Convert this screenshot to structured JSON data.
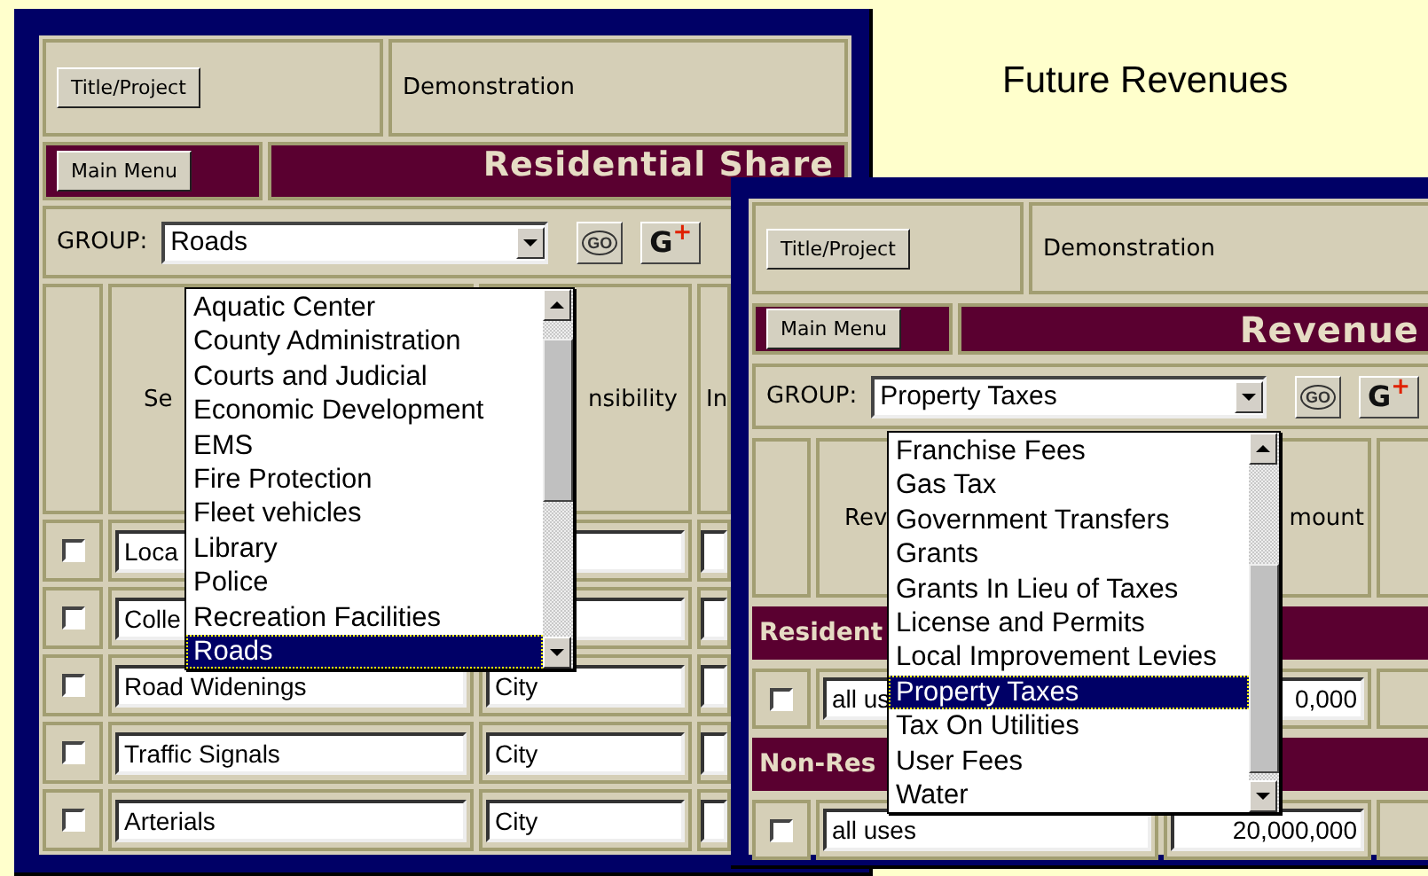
{
  "slide_title": "Future Revenues",
  "share_window": {
    "title_button": "Title/Project",
    "project": "Demonstration",
    "menu_button": "Main Menu",
    "heading": "Residential Share",
    "group_label": "GROUP:",
    "group_value": "Roads",
    "go_button": "GO",
    "add_button": {
      "letter": "G",
      "sign": "+"
    },
    "columns": [
      "Se",
      "nsibility",
      "In"
    ],
    "rows": [
      {
        "checked": false,
        "description": "Loca"
      },
      {
        "checked": false,
        "description": "Colle"
      },
      {
        "checked": false,
        "description": "Road Widenings",
        "responsibility": "City"
      },
      {
        "checked": false,
        "description": "Traffic Signals",
        "responsibility": "City"
      },
      {
        "checked": false,
        "description": "Arterials",
        "responsibility": "City"
      }
    ],
    "dropdown": [
      {
        "label": "Aquatic Center",
        "selected": false
      },
      {
        "label": "County Administration",
        "selected": false
      },
      {
        "label": "Courts and Judicial",
        "selected": false
      },
      {
        "label": "Economic Development",
        "selected": false
      },
      {
        "label": "EMS",
        "selected": false
      },
      {
        "label": "Fire Protection",
        "selected": false
      },
      {
        "label": "Fleet vehicles",
        "selected": false
      },
      {
        "label": "Library",
        "selected": false
      },
      {
        "label": "Police",
        "selected": false
      },
      {
        "label": "Recreation Facilities",
        "selected": false
      },
      {
        "label": "Roads",
        "selected": true
      }
    ]
  },
  "revenue_window": {
    "title_button": "Title/Project",
    "project": "Demonstration",
    "menu_button": "Main Menu",
    "heading": "Revenue",
    "group_label": "GROUP:",
    "group_value": "Property Taxes",
    "go_button": "GO",
    "add_button": {
      "letter": "G",
      "sign": "+"
    },
    "columns": [
      "Rev",
      "mount"
    ],
    "sections": [
      {
        "title": "Resident",
        "rows": [
          {
            "checked": false,
            "description": "all us",
            "amount": "0,000"
          }
        ]
      },
      {
        "title": "Non-Res",
        "rows": [
          {
            "checked": false,
            "description": "all uses",
            "amount": "20,000,000"
          }
        ]
      }
    ],
    "dropdown": [
      {
        "label": "Franchise Fees",
        "selected": false
      },
      {
        "label": "Gas Tax",
        "selected": false
      },
      {
        "label": "Government Transfers",
        "selected": false
      },
      {
        "label": "Grants",
        "selected": false
      },
      {
        "label": "Grants In Lieu of Taxes",
        "selected": false
      },
      {
        "label": "License and Permits",
        "selected": false
      },
      {
        "label": "Local Improvement Levies",
        "selected": false
      },
      {
        "label": "Property Taxes",
        "selected": true
      },
      {
        "label": "Tax On Utilities",
        "selected": false
      },
      {
        "label": "User Fees",
        "selected": false
      },
      {
        "label": "Water",
        "selected": false
      }
    ]
  }
}
